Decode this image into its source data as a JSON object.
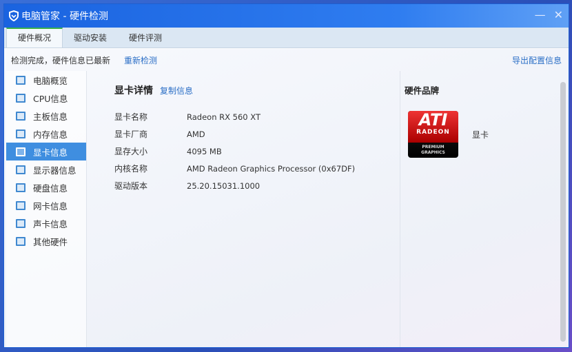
{
  "window": {
    "title": "电脑管家 - 硬件检测",
    "minimize": "—",
    "close": "✕"
  },
  "tabs": [
    {
      "label": "硬件概况"
    },
    {
      "label": "驱动安装"
    },
    {
      "label": "硬件评测"
    }
  ],
  "status": {
    "text": "检测完成，硬件信息已最新",
    "rescan": "重新检测",
    "export": "导出配置信息"
  },
  "sidebar": {
    "items": [
      {
        "label": "电脑概览"
      },
      {
        "label": "CPU信息"
      },
      {
        "label": "主板信息"
      },
      {
        "label": "内存信息"
      },
      {
        "label": "显卡信息"
      },
      {
        "label": "显示器信息"
      },
      {
        "label": "硬盘信息"
      },
      {
        "label": "网卡信息"
      },
      {
        "label": "声卡信息"
      },
      {
        "label": "其他硬件"
      }
    ],
    "active": 4
  },
  "detail": {
    "title": "显卡详情",
    "copy": "复制信息",
    "rows": [
      {
        "key": "显卡名称",
        "value": "Radeon RX 560 XT"
      },
      {
        "key": "显卡厂商",
        "value": "AMD"
      },
      {
        "key": "显存大小",
        "value": "4095 MB"
      },
      {
        "key": "内核名称",
        "value": "AMD Radeon Graphics Processor (0x67DF)"
      },
      {
        "key": "驱动版本",
        "value": "25.20.15031.1000"
      }
    ]
  },
  "brand": {
    "title": "硬件品牌",
    "label": "显卡",
    "logo_text": [
      "ATI",
      "RADEON",
      "PREMIUM",
      "GRAPHICS"
    ]
  }
}
